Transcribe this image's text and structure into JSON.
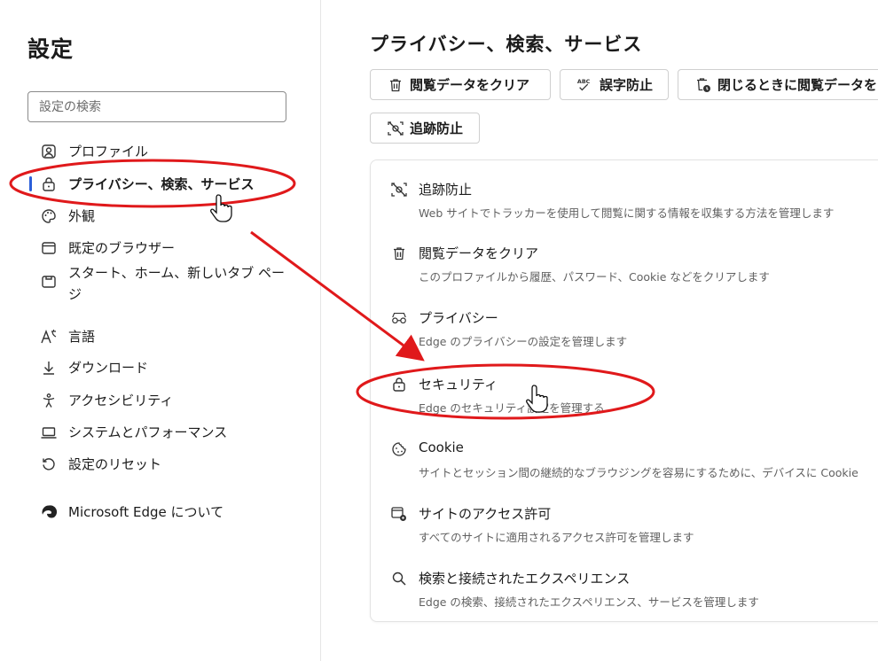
{
  "sidebar": {
    "title": "設定",
    "search_placeholder": "設定の検索",
    "items": [
      {
        "label": "プロファイル",
        "icon": "profile-icon"
      },
      {
        "label": "プライバシー、検索、サービス",
        "icon": "lock-icon",
        "active": true
      },
      {
        "label": "外観",
        "icon": "palette-icon"
      },
      {
        "label": "既定のブラウザー",
        "icon": "browser-window-icon"
      },
      {
        "label": "スタート、ホーム、新しいタブ ページ",
        "icon": "home-tab-icon"
      },
      {
        "label": "言語",
        "icon": "language-icon"
      },
      {
        "label": "ダウンロード",
        "icon": "download-icon"
      },
      {
        "label": "アクセシビリティ",
        "icon": "accessibility-icon"
      },
      {
        "label": "システムとパフォーマンス",
        "icon": "laptop-icon"
      },
      {
        "label": "設定のリセット",
        "icon": "reset-icon"
      },
      {
        "label": "Microsoft Edge について",
        "icon": "edge-logo-icon"
      }
    ]
  },
  "main": {
    "title": "プライバシー、検索、サービス",
    "chips": [
      {
        "label": "閲覧データをクリア",
        "icon": "trash-icon"
      },
      {
        "label": "誤字防止",
        "icon": "spellcheck-icon"
      },
      {
        "label": "閉じるときに閲覧データを",
        "icon": "trash-clock-icon"
      },
      {
        "label": "追跡防止",
        "icon": "tracking-prevention-icon"
      }
    ],
    "rows": [
      {
        "title": "追跡防止",
        "desc": "Web サイトでトラッカーを使用して閲覧に関する情報を収集する方法を管理します",
        "icon": "tracking-prevention-icon"
      },
      {
        "title": "閲覧データをクリア",
        "desc": "このプロファイルから履歴、パスワード、Cookie などをクリアします",
        "icon": "trash-icon"
      },
      {
        "title": "プライバシー",
        "desc": "Edge のプライバシーの設定を管理します",
        "icon": "privacy-glasses-icon"
      },
      {
        "title": "セキュリティ",
        "desc": "Edge のセキュリティ設定を管理する",
        "icon": "lock-icon"
      },
      {
        "title": "Cookie",
        "desc": "サイトとセッション間の継続的なブラウジングを容易にするために、デバイスに Cookie",
        "icon": "cookie-icon"
      },
      {
        "title": "サイトのアクセス許可",
        "desc": "すべてのサイトに適用されるアクセス許可を管理します",
        "icon": "site-permissions-icon"
      },
      {
        "title": "検索と接続されたエクスペリエンス",
        "desc": "Edge の検索、接続されたエクスペリエンス、サービスを管理します",
        "icon": "search-icon"
      }
    ]
  },
  "colors": {
    "annotation_red": "#e0191b",
    "active_indicator": "#2b5fd9"
  }
}
